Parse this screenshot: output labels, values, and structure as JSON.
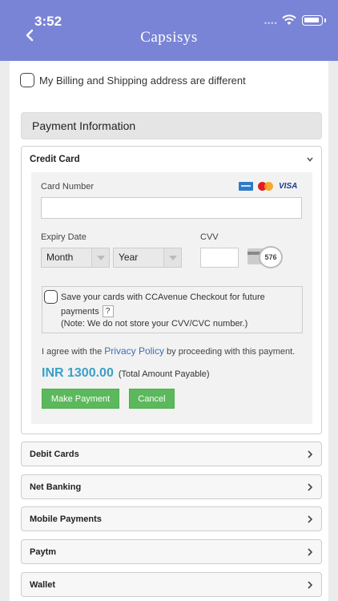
{
  "status_bar": {
    "time": "3:52",
    "signal": "••••"
  },
  "appbar": {
    "title": "Capsisys"
  },
  "billing": {
    "different_address_label": "My Billing and Shipping address are different"
  },
  "payment": {
    "section_title": "Payment Information",
    "credit_card": {
      "header": "Credit Card",
      "card_number_label": "Card Number",
      "card_brands": [
        "amex-icon",
        "mastercard-icon",
        "visa-icon"
      ],
      "visa_text": "VISA",
      "expiry_label": "Expiry Date",
      "month_value": "Month",
      "year_value": "Year",
      "cvv_label": "CVV",
      "cvv_hint": "576",
      "save_line1": "Save your cards with CCAvenue Checkout for future",
      "save_line2": "payments",
      "help_mark": "?",
      "save_note": "(Note: We do not store your CVV/CVC number.)",
      "agree_prefix": "I agree with the",
      "privacy_link": "Privacy Policy",
      "agree_suffix": "by proceeding with this payment.",
      "amount": "INR 1300.00",
      "amount_note": "(Total Amount Payable)",
      "make_payment": "Make Payment",
      "cancel": "Cancel"
    },
    "methods": [
      {
        "label": "Debit Cards"
      },
      {
        "label": "Net Banking"
      },
      {
        "label": "Mobile Payments"
      },
      {
        "label": "Paytm"
      },
      {
        "label": "Wallet"
      }
    ]
  },
  "colors": {
    "appbar": "#7a84d6",
    "button_green": "#5cb85c",
    "amount_blue": "#3aa0c8",
    "link_blue": "#3a6fb8"
  }
}
